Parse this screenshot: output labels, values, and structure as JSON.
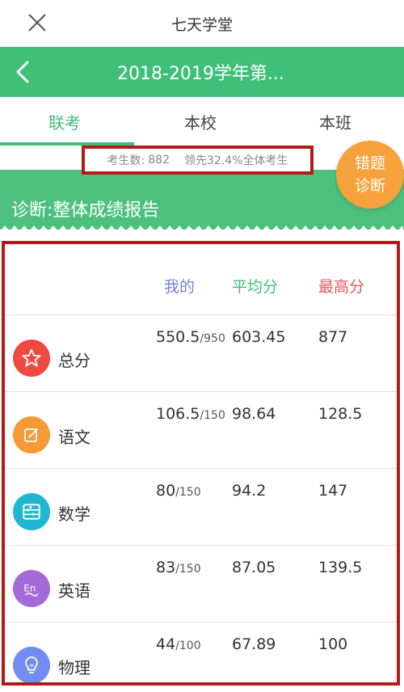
{
  "topbar": {
    "title": "七天学堂",
    "close_icon": "close-icon"
  },
  "navbar": {
    "title": "2018-2019学年第...",
    "back_icon": "chevron-left-icon"
  },
  "tabs": [
    {
      "label": "联考",
      "active": true
    },
    {
      "label": "本校",
      "active": false
    },
    {
      "label": "本班",
      "active": false
    }
  ],
  "stats": {
    "examinees_label": "考生数:",
    "examinees_value": "882",
    "lead_text": "领先32.4%全体考生"
  },
  "error_button": {
    "line1": "错题",
    "line2": "诊断"
  },
  "diagnosis_title": "诊断:整体成绩报告",
  "report": {
    "headers": {
      "mine": "我的",
      "average": "平均分",
      "highest": "最高分"
    },
    "rows": [
      {
        "subject": "总分",
        "icon": "star-icon",
        "color": "#ef4a3f",
        "mine": "550.5",
        "full": "/950",
        "average": "603.45",
        "highest": "877"
      },
      {
        "subject": "语文",
        "icon": "edit-icon",
        "color": "#f59a35",
        "mine": "106.5",
        "full": "/150",
        "average": "98.64",
        "highest": "128.5"
      },
      {
        "subject": "数学",
        "icon": "abacus-icon",
        "color": "#20b6d0",
        "mine": "80",
        "full": "/150",
        "average": "94.2",
        "highest": "147"
      },
      {
        "subject": "英语",
        "icon": "english-icon",
        "color": "#a46ad8",
        "mine": "83",
        "full": "/150",
        "average": "87.05",
        "highest": "139.5"
      },
      {
        "subject": "物理",
        "icon": "lightbulb-icon",
        "color": "#6f8ef0",
        "mine": "44",
        "full": "/100",
        "average": "67.89",
        "highest": "100"
      }
    ]
  },
  "colors": {
    "brand_green": "#3fbf77",
    "highlight_red": "#b31b1b",
    "accent_orange": "#f6a23c",
    "mine_blue": "#6f7ee0",
    "max_red": "#e05a5a"
  }
}
